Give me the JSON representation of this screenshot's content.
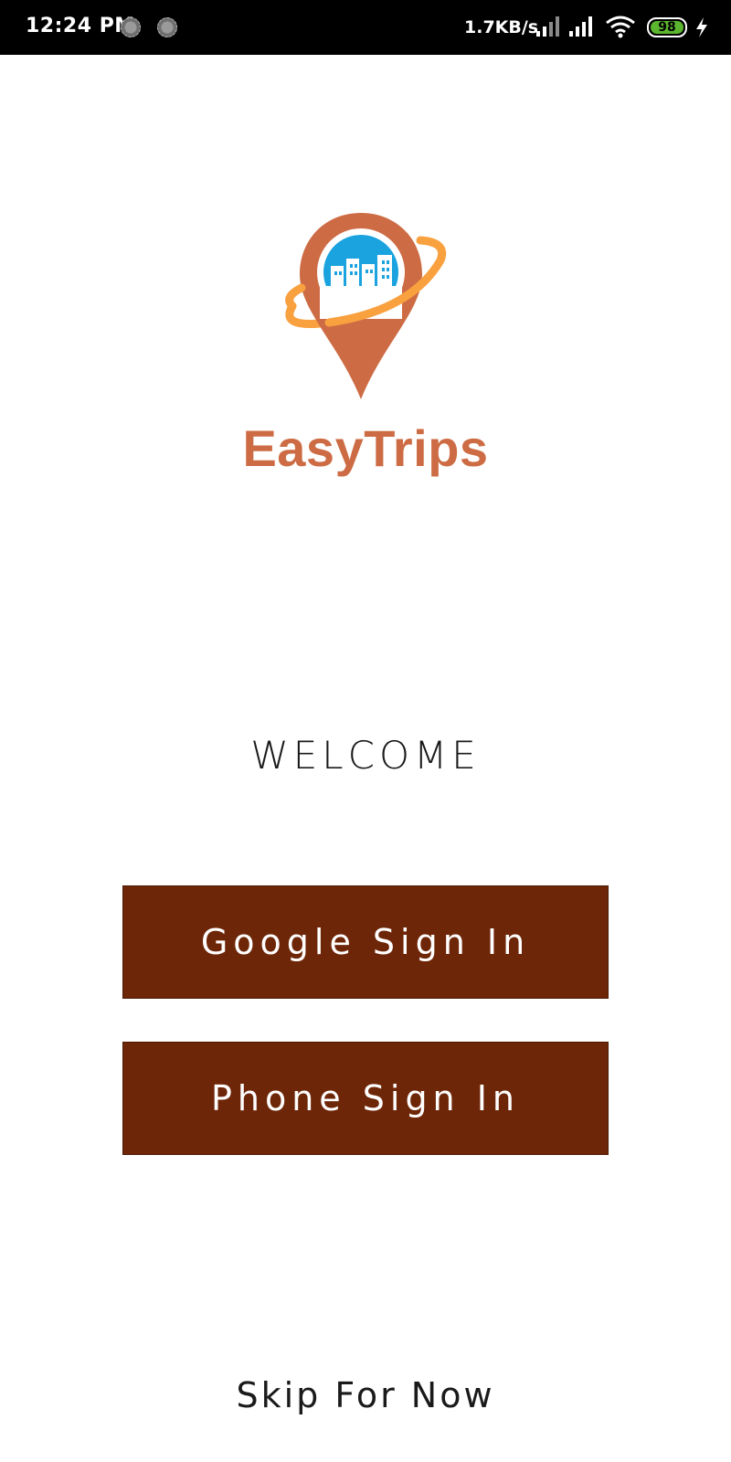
{
  "status_bar": {
    "time": "12:24 PM",
    "network_speed": "1.7KB/s",
    "battery_level": "98",
    "icons": [
      "notification-icon",
      "notification-icon",
      "signal-icon",
      "signal-icon",
      "wifi-icon",
      "battery-icon",
      "charging-icon"
    ]
  },
  "brand": {
    "name": "EasyTrips",
    "logo": "map-pin-city-logo",
    "colors": {
      "primary": "#cd6c44",
      "ring": "#f9a03f",
      "sky": "#1aa3df"
    }
  },
  "welcome": {
    "title": "WELCOME"
  },
  "actions": {
    "google_sign_in": "Google Sign In",
    "phone_sign_in": "Phone Sign In",
    "skip": "Skip For Now",
    "button_color": "#6e2608"
  }
}
